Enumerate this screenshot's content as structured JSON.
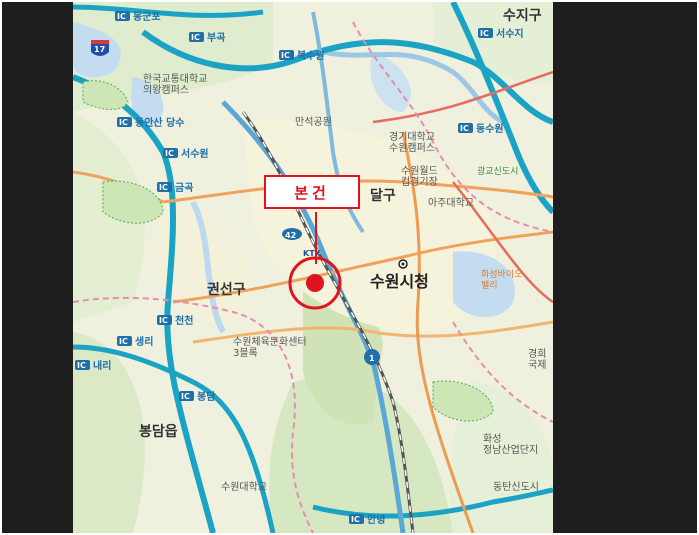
{
  "callout_label": "본건",
  "marker_color": "#e0141e",
  "city_hall": "수원시청",
  "districts": {
    "gwonseon": "권선구",
    "paldal": "달구",
    "bongdam": "봉담읍",
    "suji": "수지구"
  },
  "interchanges": {
    "dongtan_mu": "동군포",
    "bugok": "부곡",
    "bugsuwon": "북수원",
    "suji": "서수지",
    "dongansan": "동안산 당수",
    "seosuwon": "서수원",
    "geumgok": "금곡",
    "dongsuwon": "동수원",
    "cheoncheon": "천천",
    "saengli": "생리",
    "naeri": "내리",
    "bongdam": "봉담",
    "anyeong": "안녕"
  },
  "places": {
    "hanyang_erica": "한국교통대학교\n의왕캠퍼스",
    "kyonggi_univ": "경기대학교\n수원캠퍼스",
    "manseok_park": "만석공원",
    "suwon_world": "수원월드\n컵경기장",
    "ajou_univ": "아주대학교",
    "suwon_univ": "수원대학교",
    "suwon_sports": "수원체육문화센터\n3블록",
    "gwanggyo": "광교신도시",
    "hwaseong_bio": "화성바이오\n밸리",
    "hwaseong_tech": "화성\n정남산업단지",
    "hwaseong_new": "동탄신도시",
    "ict": "경희\n국제"
  },
  "route_badges": {
    "expressway_17": "17",
    "route_42": "42",
    "route_1": "1",
    "ktx": "KTX"
  },
  "ic_badge": "IC"
}
